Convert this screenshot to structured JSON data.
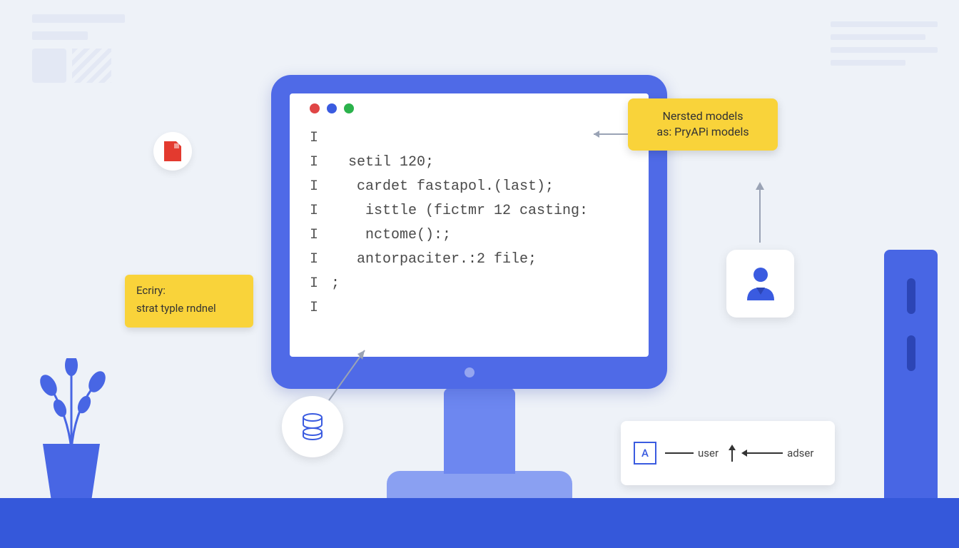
{
  "code": {
    "lines": [
      "",
      "  setil 120;",
      "   cardet fastapol.(last);",
      "    isttle (fictmr 12 casting:",
      "    nctome():;",
      "   antorpaciter.:2 file;",
      ";",
      ""
    ],
    "gutter_char": "I"
  },
  "note_left": {
    "title": "Ecriry:",
    "body": "strat typle rndnel"
  },
  "note_right": {
    "line1": "Nersted models",
    "line2": "as: PryAPi models"
  },
  "diagram": {
    "box_letter": "A",
    "label1": "user",
    "label2": "adser"
  },
  "colors": {
    "accent": "#4f6ae7",
    "note": "#f9d33a",
    "desk": "#3558da"
  }
}
